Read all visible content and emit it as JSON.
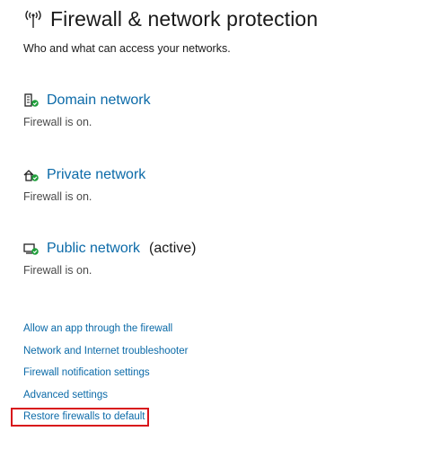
{
  "header": {
    "title": "Firewall & network protection",
    "subtitle": "Who and what can access your networks.",
    "icon": "wireless-antenna-icon"
  },
  "networks": [
    {
      "name": "Domain network",
      "status": "Firewall is on.",
      "icon": "domain-network-icon",
      "active_label": ""
    },
    {
      "name": "Private network",
      "status": "Firewall is on.",
      "icon": "private-network-icon",
      "active_label": ""
    },
    {
      "name": "Public network",
      "status": "Firewall is on.",
      "icon": "public-network-icon",
      "active_label": "(active)"
    }
  ],
  "links": [
    "Allow an app through the firewall",
    "Network and Internet troubleshooter",
    "Firewall notification settings",
    "Advanced settings",
    "Restore firewalls to default"
  ],
  "colors": {
    "link": "#0b6aa8",
    "highlight": "#d8141b",
    "status_ok": "#1e9e3a"
  }
}
